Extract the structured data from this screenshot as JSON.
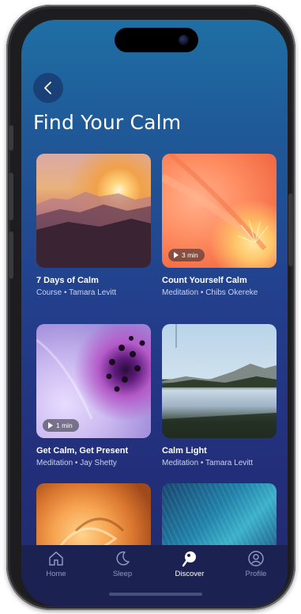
{
  "page": {
    "title": "Find Your Calm"
  },
  "cards": [
    {
      "title": "7 Days of Calm",
      "subtitle": "Course • Tamara Levitt",
      "image": "sunset-mountains",
      "duration": ""
    },
    {
      "title": "Count Yourself Calm",
      "subtitle": "Meditation • Chibs Okereke",
      "image": "orange-flower-closeup",
      "duration": "3 min"
    },
    {
      "title": "Get Calm, Get Present",
      "subtitle": "Meditation • Jay Shetty",
      "image": "purple-flower-closeup",
      "duration": "1 min"
    },
    {
      "title": "Calm Light",
      "subtitle": "Meditation • Tamara Levitt",
      "image": "mountain-lake",
      "duration": ""
    },
    {
      "title": "",
      "subtitle": "",
      "image": "orange-rose",
      "duration": ""
    },
    {
      "title": "",
      "subtitle": "",
      "image": "blue-feathers",
      "duration": ""
    }
  ],
  "tabbar": {
    "items": [
      {
        "label": "Home",
        "icon": "home-icon",
        "active": false
      },
      {
        "label": "Sleep",
        "icon": "moon-icon",
        "active": false
      },
      {
        "label": "Discover",
        "icon": "discover-icon",
        "active": true
      },
      {
        "label": "Profile",
        "icon": "profile-icon",
        "active": false
      }
    ]
  },
  "colors": {
    "background_top": "#1f6fa4",
    "background_bottom": "#1f2a6b",
    "tabbar": "#1b2150",
    "text_primary": "#ffffff",
    "text_secondary": "#c9d3ee",
    "tab_inactive": "#8f97c2"
  }
}
